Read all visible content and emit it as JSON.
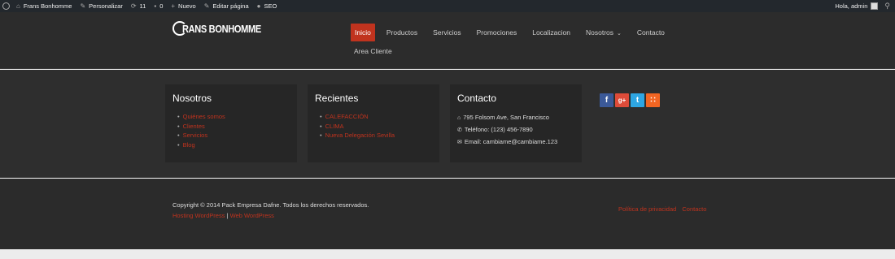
{
  "admin_bar": {
    "site_name": "Frans Bonhomme",
    "customize": "Personalizar",
    "updates_count": "11",
    "comments_count": "0",
    "new": "Nuevo",
    "edit_page": "Editar página",
    "seo": "SEO",
    "greeting": "Hola, admin"
  },
  "header": {
    "logo_text": "RANS BONHOMME",
    "nav": [
      {
        "label": "Inicio",
        "active": true
      },
      {
        "label": "Productos"
      },
      {
        "label": "Servicios"
      },
      {
        "label": "Promociones"
      },
      {
        "label": "Localizacion"
      },
      {
        "label": "Nosotros"
      },
      {
        "label": "Contacto"
      }
    ],
    "nav_second_row": "Area Cliente"
  },
  "widgets": {
    "nosotros": {
      "title": "Nosotros",
      "items": [
        "Quiénes somos",
        "Clientes",
        "Servicios",
        "Blog"
      ]
    },
    "recientes": {
      "title": "Recientes",
      "items": [
        "CALEFACCIÓN",
        "CLIMA",
        "Nueva Delegación Sevilla"
      ]
    },
    "contacto": {
      "title": "Contacto",
      "address": "795 Folsom Ave, San Francisco",
      "phone": "Teléfono: (123) 456-7890",
      "email": "Email: cambiame@cambiame.123"
    },
    "social": [
      {
        "icon": "facebook-icon",
        "glyph": "f",
        "color": "#3b5998"
      },
      {
        "icon": "google-plus-icon",
        "glyph": "g+",
        "color": "#dd4b39"
      },
      {
        "icon": "twitter-icon",
        "glyph": "t",
        "color": "#2ea6e3"
      },
      {
        "icon": "rss-icon",
        "glyph": "∷",
        "color": "#f26522"
      }
    ]
  },
  "footer": {
    "copyright": "Copyright © 2014 Pack Empresa Dafne. Todos los derechos reservados.",
    "hosting_link": "Hosting WordPress",
    "separator": "|",
    "web_link": "Web WordPress",
    "privacy": "Política de privacidad",
    "contact": "Contacto"
  },
  "colors": {
    "accent": "#c0331e",
    "admin_bar": "#23282d",
    "dark_bg": "#2c2c2c"
  }
}
